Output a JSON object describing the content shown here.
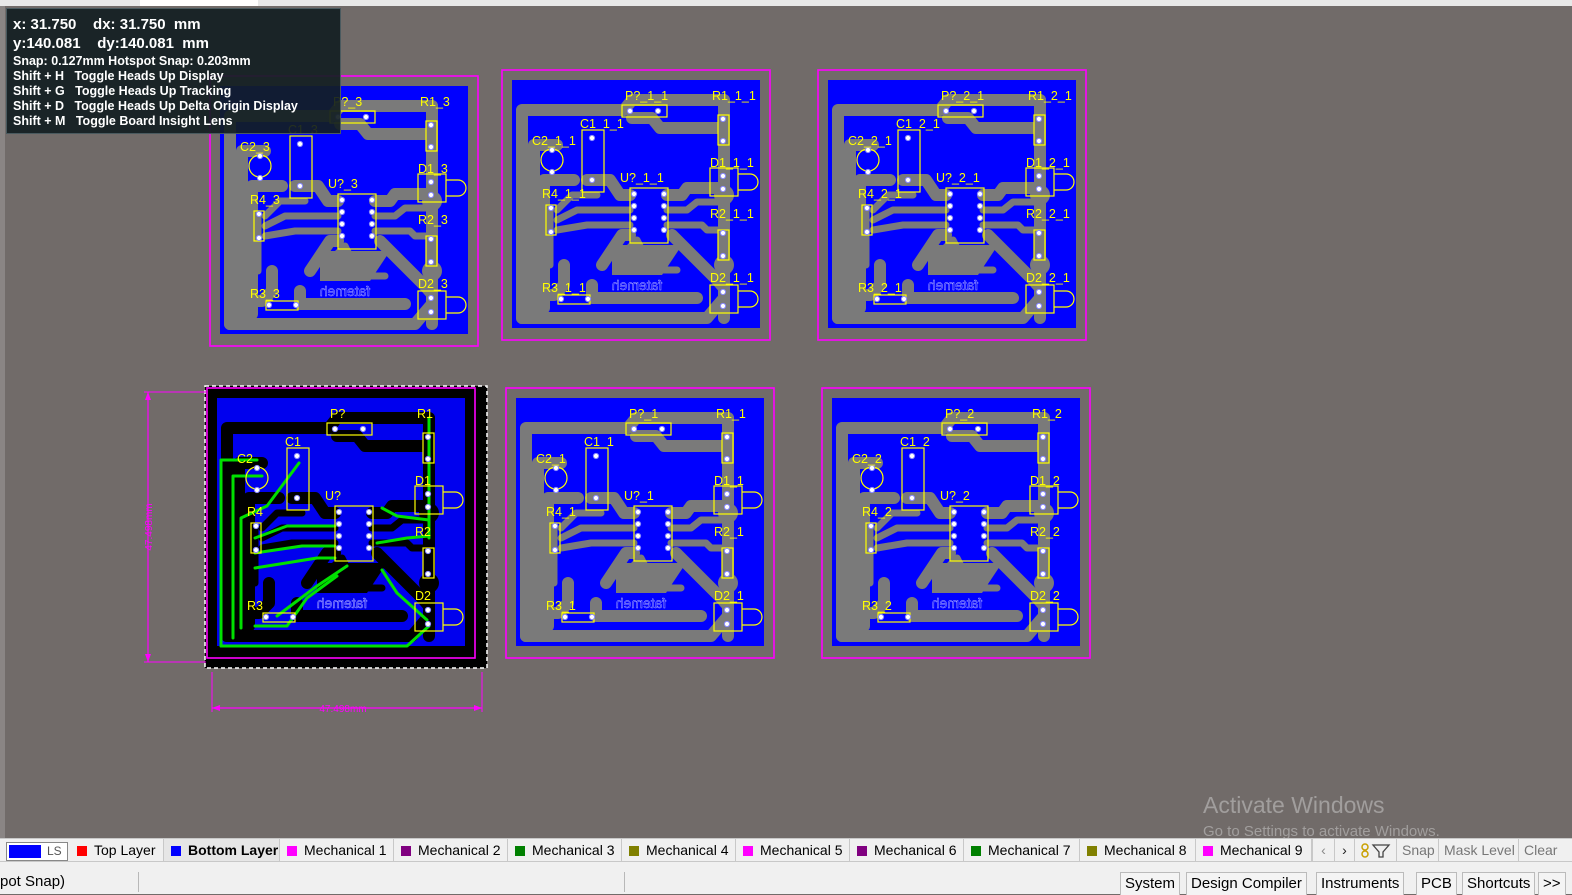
{
  "hud": {
    "line_x": "x: 31.750    dx: 31.750  mm",
    "line_y": "y:140.081    dy:140.081  mm",
    "snap": "Snap: 0.127mm Hotspot Snap: 0.203mm",
    "shortcuts": [
      "Shift + H   Toggle Heads Up Display",
      "Shift + G   Toggle Heads Up Tracking",
      "Shift + D   Toggle Heads Up Delta Origin Display",
      "Shift + M   Toggle Board Insight Lens"
    ]
  },
  "boards": [
    {
      "suffix": "_3",
      "p": "P?_3",
      "selected": false
    },
    {
      "suffix": "_1_1",
      "p": "P?_1_1",
      "selected": false
    },
    {
      "suffix": "_2_1",
      "p": "P?_2_1",
      "selected": false
    },
    {
      "suffix": "",
      "p": "P?",
      "selected": true
    },
    {
      "suffix": "_1",
      "p": "P?_1",
      "selected": false
    },
    {
      "suffix": "_2",
      "p": "P?_2",
      "selected": false
    }
  ],
  "board_text": "fatemeh",
  "dimension_horizontal": "47.498mm",
  "dimension_vertical": "47.498mm",
  "colors": {
    "canvas": "#716b69",
    "board_fill": "#0000ff",
    "board_outline": "#ff00ff",
    "track": "#7a7a7a",
    "selected_track": "#00e000",
    "silkscreen": "#ffff00"
  },
  "layer_set_label": "LS",
  "layers": [
    {
      "name": "Top Layer",
      "color": "#ff0000",
      "active": false
    },
    {
      "name": "Bottom Layer",
      "color": "#0000ff",
      "active": true
    },
    {
      "name": "Mechanical 1",
      "color": "#ff00ff",
      "active": false
    },
    {
      "name": "Mechanical 2",
      "color": "#800080",
      "active": false
    },
    {
      "name": "Mechanical 3",
      "color": "#008000",
      "active": false
    },
    {
      "name": "Mechanical 4",
      "color": "#808000",
      "active": false
    },
    {
      "name": "Mechanical 5",
      "color": "#ff00ff",
      "active": false
    },
    {
      "name": "Mechanical 6",
      "color": "#800080",
      "active": false
    },
    {
      "name": "Mechanical 7",
      "color": "#008000",
      "active": false
    },
    {
      "name": "Mechanical 8",
      "color": "#808000",
      "active": false
    },
    {
      "name": "Mechanical 9",
      "color": "#ff00ff",
      "active": false
    }
  ],
  "layer_nav": {
    "prev": "‹",
    "next": "›"
  },
  "layer_buttons": {
    "snap": "Snap",
    "mask": "Mask Level",
    "clear": "Clear"
  },
  "status": {
    "left_text": "pot Snap)",
    "panels": [
      "System",
      "Design Compiler",
      "Instruments",
      "PCB",
      "Shortcuts"
    ],
    "more": ">>"
  },
  "watermark": {
    "title": "Activate Windows",
    "subtitle": "Go to Settings to activate Windows."
  }
}
